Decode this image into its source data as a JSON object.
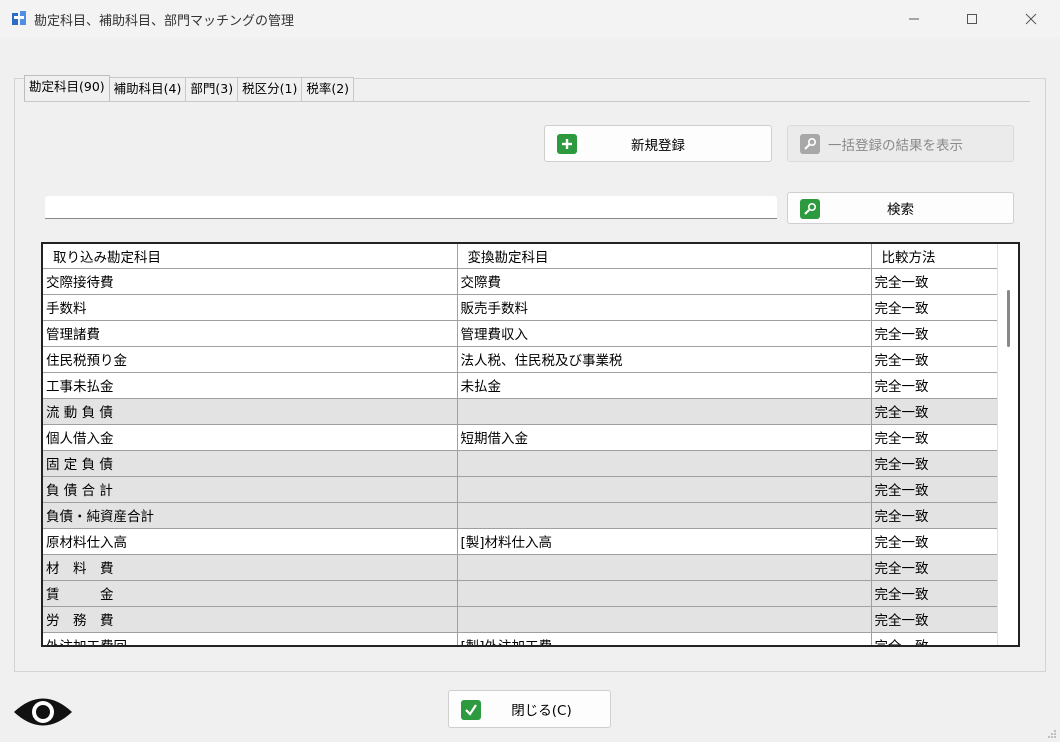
{
  "window": {
    "title": "勘定科目、補助科目、部門マッチングの管理",
    "icons": {
      "minimize": "minimize-icon",
      "maximize": "maximize-icon",
      "close": "close-icon",
      "app": "app-icon"
    }
  },
  "tabs": [
    {
      "label": "勘定科目(90)",
      "active": true
    },
    {
      "label": "補助科目(4)",
      "active": false
    },
    {
      "label": "部門(3)",
      "active": false
    },
    {
      "label": "税区分(1)",
      "active": false
    },
    {
      "label": "税率(2)",
      "active": false
    }
  ],
  "toolbar": {
    "new_label": "新規登録",
    "bulk_result_label": "一括登録の結果を表示",
    "search_label": "検索",
    "search_value": ""
  },
  "table": {
    "headers": [
      "取り込み勘定科目",
      "変換勘定科目",
      "比較方法"
    ],
    "rows": [
      {
        "source": "交際接待費",
        "target": "交際費",
        "method": "完全一致",
        "subtotal": false
      },
      {
        "source": "手数料",
        "target": "販売手数料",
        "method": "完全一致",
        "subtotal": false
      },
      {
        "source": "管理諸費",
        "target": "管理費収入",
        "method": "完全一致",
        "subtotal": false
      },
      {
        "source": "住民税預り金",
        "target": "法人税、住民税及び事業税",
        "method": "完全一致",
        "subtotal": false
      },
      {
        "source": "工事未払金",
        "target": "未払金",
        "method": "完全一致",
        "subtotal": false
      },
      {
        "source": "流 動 負 債",
        "target": "",
        "method": "完全一致",
        "subtotal": true
      },
      {
        "source": "個人借入金",
        "target": "短期借入金",
        "method": "完全一致",
        "subtotal": false
      },
      {
        "source": "固 定 負 債",
        "target": "",
        "method": "完全一致",
        "subtotal": true
      },
      {
        "source": "負 債 合 計",
        "target": "",
        "method": "完全一致",
        "subtotal": true
      },
      {
        "source": "負債・純資産合計",
        "target": "",
        "method": "完全一致",
        "subtotal": true
      },
      {
        "source": "原材料仕入高",
        "target": "[製]材料仕入高",
        "method": "完全一致",
        "subtotal": false
      },
      {
        "source": "材　料　費",
        "target": "",
        "method": "完全一致",
        "subtotal": true
      },
      {
        "source": "賃　　　金",
        "target": "",
        "method": "完全一致",
        "subtotal": true
      },
      {
        "source": "労　務　費",
        "target": "",
        "method": "完全一致",
        "subtotal": true
      },
      {
        "source": "外注加工費回",
        "target": "[製]外注加工費",
        "method": "完全一致",
        "subtotal": false
      }
    ]
  },
  "footer": {
    "close_label": "閉じる(C)",
    "eye_icon": "eye-icon"
  },
  "colors": {
    "accent_green": "#2e9a3f",
    "subtotal_row": "#e3e3e3",
    "disabled_text": "#8a8a8a"
  }
}
